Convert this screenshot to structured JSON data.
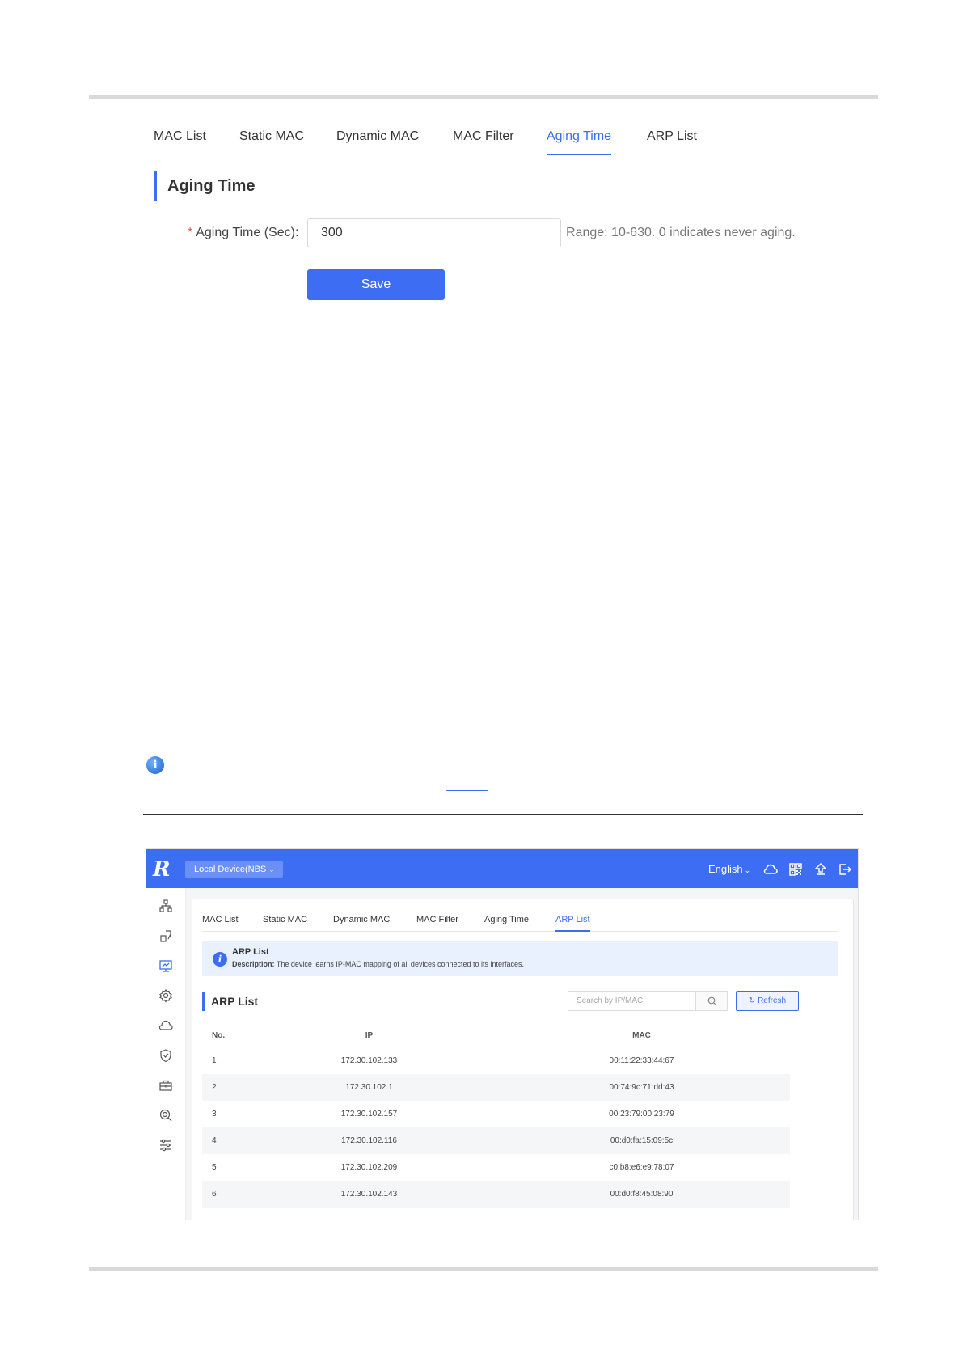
{
  "aging_panel": {
    "tabs": [
      "MAC List",
      "Static MAC",
      "Dynamic MAC",
      "MAC Filter",
      "Aging Time",
      "ARP List"
    ],
    "active_tab": "Aging Time",
    "section_title": "Aging Time",
    "required_mark": "*",
    "field_label": "Aging Time (Sec):",
    "field_value": "300",
    "field_hint": "Range: 10-630. 0 indicates never aging.",
    "save_label": "Save"
  },
  "arp_screenshot": {
    "logo": "R",
    "device_selector": "Local Device(NBS",
    "language": "English",
    "header_icons": [
      "cloud-icon",
      "qr-code-icon",
      "upload-icon",
      "logout-icon"
    ],
    "sidebar_icons": [
      "network-topology-icon",
      "devices-icon",
      "monitor-icon",
      "settings-icon",
      "cloud-icon",
      "shield-icon",
      "toolbox-icon",
      "diagnostics-icon",
      "sliders-icon"
    ],
    "tabs": [
      "MAC List",
      "Static MAC",
      "Dynamic MAC",
      "MAC Filter",
      "Aging Time",
      "ARP List"
    ],
    "active_tab": "ARP List",
    "notice": {
      "title": "ARP List",
      "desc_label": "Description:",
      "desc_text": "The device learns IP-MAC mapping of all devices connected to its interfaces."
    },
    "section_title": "ARP List",
    "search_placeholder": "Search by IP/MAC",
    "refresh_label": "Refresh",
    "table": {
      "headers": [
        "No.",
        "IP",
        "MAC"
      ],
      "rows": [
        [
          "1",
          "172.30.102.133",
          "00:11:22:33:44:67"
        ],
        [
          "2",
          "172.30.102.1",
          "00:74:9c:71:dd:43"
        ],
        [
          "3",
          "172.30.102.157",
          "00:23:79:00:23:79"
        ],
        [
          "4",
          "172.30.102.116",
          "00:d0:fa:15:09:5c"
        ],
        [
          "5",
          "172.30.102.209",
          "c0:b8:e6:e9:78:07"
        ],
        [
          "6",
          "172.30.102.143",
          "00:d0:f8:45:08:90"
        ]
      ]
    }
  },
  "colors": {
    "accent": "#3d6df2",
    "required": "#f04b4b"
  }
}
